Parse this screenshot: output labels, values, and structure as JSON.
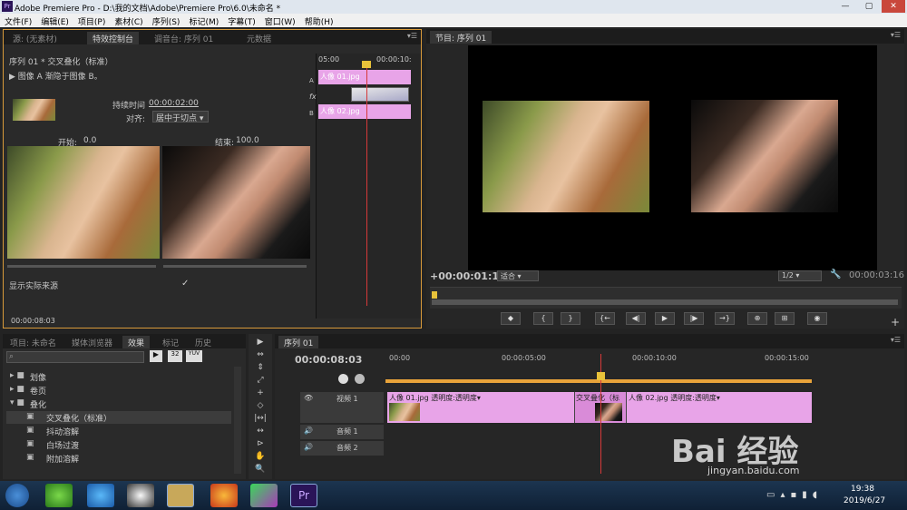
{
  "window": {
    "title": "Adobe Premiere Pro - D:\\我的文档\\Adobe\\Premiere Pro\\6.0\\未命名 *",
    "logo": "Pr",
    "minimize": "—",
    "maximize": "▢",
    "close": "✕"
  },
  "menu": [
    "文件(F)",
    "编辑(E)",
    "项目(P)",
    "素材(C)",
    "序列(S)",
    "标记(M)",
    "字幕(T)",
    "窗口(W)",
    "帮助(H)"
  ],
  "effect_panel": {
    "tabs": [
      "源: (无素材)",
      "特效控制台",
      "调音台: 序列 01",
      "元数据"
    ],
    "header": "序列 01 * 交叉叠化（标准）",
    "transition_line": "图像 A 渐隐于图像 B。",
    "duration_label": "持续时间",
    "duration_value": "00:00:02:00",
    "align_label": "对齐:",
    "align_value": "居中于切点",
    "start_label": "开始:",
    "start_value": "0.0",
    "end_label": "结束:",
    "end_value": "100.0",
    "show_source_label": "显示实际来源",
    "mini_times": [
      "05:00",
      "00:00:10:"
    ],
    "clip_a": "人像 01.jpg",
    "clip_b": "人像 02.jpg",
    "track_a": "A",
    "track_b": "B",
    "fx": "fx",
    "current_time": "00:00:08:03"
  },
  "program": {
    "tab": "节目: 序列 01",
    "timecode": "+00:00:01:16",
    "fit": "适合",
    "resolution": "1/2",
    "duration": "00:00:03:16",
    "transport": [
      "◆",
      "{",
      "}",
      "{←",
      "◀|",
      "▶",
      "|▶",
      "→}",
      "⊕",
      "⊞",
      "◉"
    ]
  },
  "project_panel": {
    "tabs": [
      "项目: 未命名",
      "媒体浏览器",
      "效果",
      "标记",
      "历史"
    ],
    "badges": [
      "32",
      "YUV"
    ],
    "tree": [
      {
        "label": "划像",
        "type": "folder",
        "level": 1,
        "open": false
      },
      {
        "label": "卷页",
        "type": "folder",
        "level": 1,
        "open": false
      },
      {
        "label": "叠化",
        "type": "folder",
        "level": 1,
        "open": true
      },
      {
        "label": "交叉叠化（标准）",
        "type": "item",
        "level": 2,
        "selected": true
      },
      {
        "label": "抖动溶解",
        "type": "item",
        "level": 2
      },
      {
        "label": "白场过渡",
        "type": "item",
        "level": 2
      },
      {
        "label": "附加溶解",
        "type": "item",
        "level": 2
      }
    ]
  },
  "tools": [
    "▶",
    "⇔",
    "⇕",
    "⤢",
    "+",
    "◇",
    "|↔|",
    "↔",
    "⊳",
    "✋",
    "🔍"
  ],
  "timeline": {
    "tab": "序列 01",
    "current_time": "00:00:08:03",
    "ruler": [
      "00:00",
      "00:00:05:00",
      "00:00:10:00",
      "00:00:15:00"
    ],
    "tracks": [
      {
        "name": "视频 1",
        "kind": "video"
      },
      {
        "name": "音频 1",
        "kind": "audio"
      },
      {
        "name": "音频 2",
        "kind": "audio"
      }
    ],
    "clips": [
      {
        "name": "人像 01.jpg",
        "effect": "透明度:透明度▾"
      },
      {
        "name": "交叉叠化（标",
        "effect": ""
      },
      {
        "name": "人像 02.jpg",
        "effect": "透明度:透明度▾"
      }
    ]
  },
  "watermark": {
    "brand": "Bai 经验",
    "url": "jingyan.baidu.com"
  },
  "taskbar": {
    "time": "19:38",
    "date": "2019/6/27",
    "pr_label": "Pr"
  },
  "colors": {
    "accent": "#e8a33a",
    "clip_pink": "#e8a4e8",
    "playhead": "#d63a3a"
  }
}
